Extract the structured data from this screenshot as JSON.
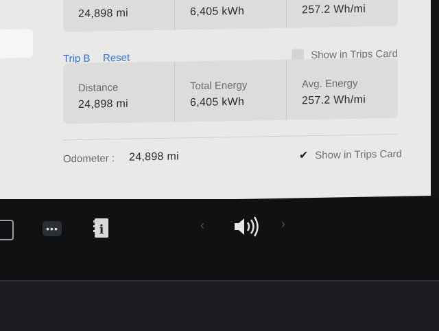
{
  "trip_a": {
    "distance_value": "24,898 mi",
    "energy_value": "6,405 kWh",
    "avg_energy_value": "257.2 Wh/mi"
  },
  "trip_b": {
    "name": "Trip B",
    "reset_label": "Reset",
    "show_in_trips_card_label": "Show in Trips Card",
    "show_in_trips_card_checked": false,
    "distance_label": "Distance",
    "distance_value": "24,898 mi",
    "energy_label": "Total Energy",
    "energy_value": "6,405 kWh",
    "avg_energy_label": "Avg. Energy",
    "avg_energy_value": "257.2 Wh/mi"
  },
  "odometer": {
    "label": "Odometer :",
    "value": "24,898 mi",
    "show_in_trips_card_label": "Show in Trips Card",
    "show_in_trips_card_checked": true
  },
  "taskbar": {
    "more_icon": "more-icon",
    "info_icon": "info-icon",
    "volume_icon": "speaker-volume-icon",
    "prev_icon": "chevron-left-icon",
    "next_icon": "chevron-right-icon"
  },
  "colors": {
    "accent": "#2f6fd6",
    "panel_bg": "#e9e9e7",
    "card_bg": "#dcdcda",
    "taskbar_bg": "#0f1113"
  }
}
